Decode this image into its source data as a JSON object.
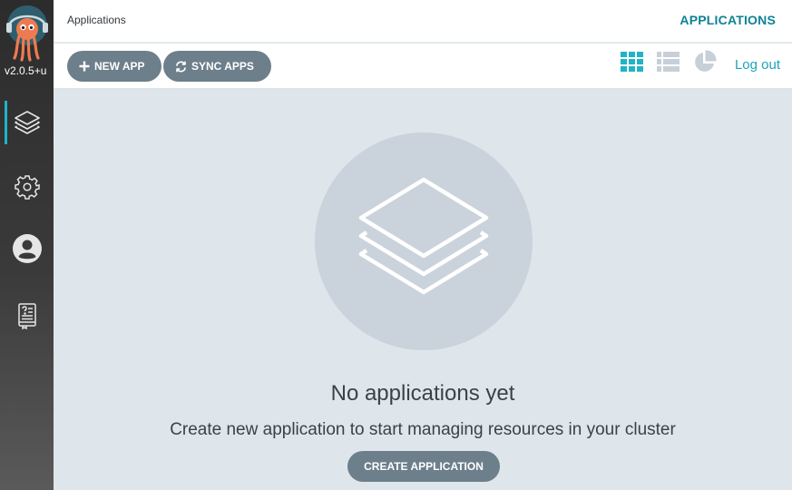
{
  "sidebar": {
    "version": "v2.0.5+u",
    "logo_icon": "argo-octopus-logo",
    "items": [
      {
        "name": "applications",
        "icon": "layers-icon",
        "active": true
      },
      {
        "name": "settings",
        "icon": "gear-icon",
        "active": false
      },
      {
        "name": "user-info",
        "icon": "user-icon",
        "active": false
      },
      {
        "name": "documentation",
        "icon": "help-book-icon",
        "active": false
      }
    ]
  },
  "header": {
    "breadcrumb": "Applications",
    "title": "APPLICATIONS"
  },
  "toolbar": {
    "new_app_label": "NEW APP",
    "sync_apps_label": "SYNC APPS",
    "view_modes": [
      "tiles-view-icon",
      "list-view-icon",
      "summary-pie-icon"
    ],
    "active_view": "tiles",
    "logout_label": "Log out"
  },
  "empty_state": {
    "title": "No applications yet",
    "description": "Create new application to start managing resources in your cluster",
    "create_label": "CREATE APPLICATION"
  },
  "colors": {
    "accent": "#0e8295",
    "link": "#1aa5bb",
    "button": "#6d7f8b",
    "background": "#dee6eb",
    "sidebar": "#2c2c2c"
  }
}
